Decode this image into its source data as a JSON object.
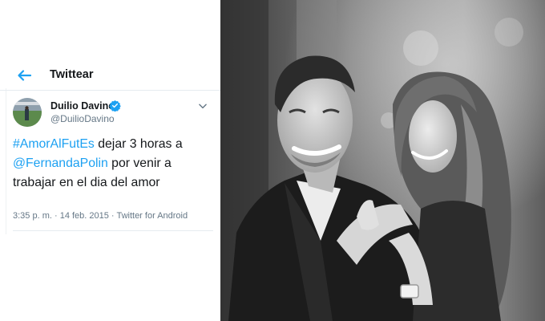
{
  "header": {
    "back_icon": "arrow-left-icon",
    "title": "Twittear"
  },
  "tweet": {
    "author_name": "Duilio Davino",
    "author_handle": "@DuilioDavino",
    "verified_icon": "verified-badge-icon",
    "menu_icon": "chevron-down-icon",
    "hashtag": "#AmorAlFutEs",
    "text_part1": " dejar 3 horas a ",
    "mention": "@FernandaPolin",
    "text_part2": " por venir a trabajar en el dia del amor",
    "time": "3:35 p. m.",
    "separator": " · ",
    "date": "14 feb. 2015",
    "source": "Twitter for Android"
  },
  "colors": {
    "accent": "#1da1f2",
    "text": "#14171a",
    "muted": "#657786"
  }
}
